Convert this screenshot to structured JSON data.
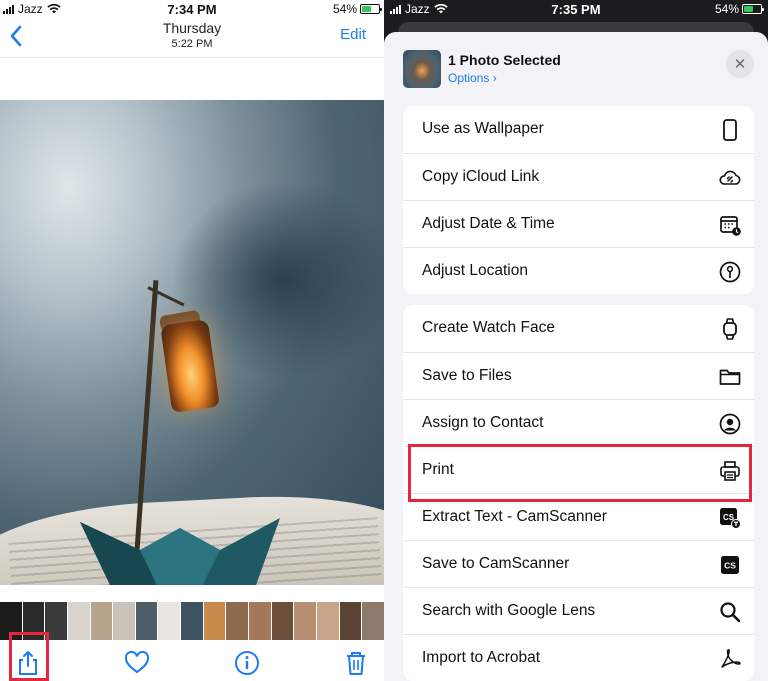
{
  "left": {
    "status": {
      "carrier": "Jazz",
      "time": "7:34 PM",
      "battery": "54%"
    },
    "nav": {
      "title": "Thursday",
      "subtitle": "5:22 PM",
      "edit": "Edit"
    },
    "thumb_colors": [
      "#1b1b1b",
      "#2a2a2a",
      "#3a3a3a",
      "#d8d3cc",
      "#b8a48c",
      "#c9c2b8",
      "#4d5e66",
      "#e9e6e1",
      "#3d5361",
      "#c68a4a",
      "#8f6a4c",
      "#a5785a",
      "#6d4e3a",
      "#b98f72",
      "#caa489",
      "#5a4333",
      "#8d7a6a"
    ]
  },
  "right": {
    "status": {
      "carrier": "Jazz",
      "time": "7:35 PM",
      "battery": "54%"
    },
    "header": {
      "title": "1 Photo Selected",
      "options": "Options ›",
      "close": "✕"
    },
    "group1": [
      {
        "label": "Use as Wallpaper",
        "icon": "phone-icon"
      },
      {
        "label": "Copy iCloud Link",
        "icon": "cloud-link-icon"
      },
      {
        "label": "Adjust Date & Time",
        "icon": "calendar-clock-icon"
      },
      {
        "label": "Adjust Location",
        "icon": "location-info-icon"
      }
    ],
    "group2": [
      {
        "label": "Create Watch Face",
        "icon": "watch-icon"
      },
      {
        "label": "Save to Files",
        "icon": "folder-icon"
      },
      {
        "label": "Assign to Contact",
        "icon": "contact-icon"
      },
      {
        "label": "Print",
        "icon": "printer-icon"
      },
      {
        "label": "Extract Text - CamScanner",
        "icon": "camscanner-text-icon"
      },
      {
        "label": "Save to CamScanner",
        "icon": "camscanner-icon"
      },
      {
        "label": "Search with Google Lens",
        "icon": "search-icon"
      },
      {
        "label": "Import to Acrobat",
        "icon": "acrobat-icon"
      }
    ]
  },
  "colors": {
    "accent": "#1a7cf3",
    "highlight": "#e5263f"
  }
}
